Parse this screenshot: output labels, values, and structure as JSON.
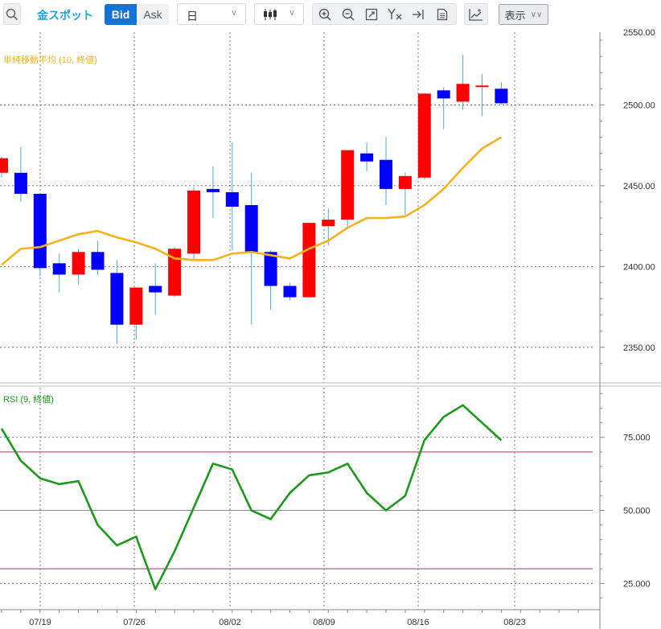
{
  "toolbar": {
    "symbol": "金スポット",
    "bid_label": "Bid",
    "ask_label": "Ask",
    "period_select": "日",
    "display_label": "表示",
    "icons": [
      "search-icon",
      "candlestick-icon",
      "zoom-in-icon",
      "zoom-out-icon",
      "fit-icon",
      "price-label-icon",
      "scroll-end-icon",
      "document-icon",
      "add-indicator-icon",
      "chevron-down-icon"
    ]
  },
  "colors": {
    "up": "#ff0000",
    "down": "#0000ff",
    "sma": "#f5b21c",
    "rsi": "#1d9a1d",
    "rsi_band": "#d94f8c",
    "grid": "#555555",
    "accent": "#1473d6"
  },
  "chart_data": [
    {
      "type": "candlestick",
      "indicator_label": "単純移動平均 (10, 終値)",
      "x_ticks": [
        "07/19",
        "07/26",
        "08/02",
        "08/09",
        "08/16",
        "08/23"
      ],
      "y_ticks": [
        "2350.00",
        "2400.00",
        "2450.00",
        "2500.00"
      ],
      "y_top_partial": "2550.00",
      "ylim": [
        2330,
        2545
      ],
      "candles": [
        {
          "o": 2458,
          "h": 2468,
          "l": 2455,
          "c": 2467
        },
        {
          "o": 2458,
          "h": 2474,
          "l": 2440,
          "c": 2445
        },
        {
          "o": 2445,
          "h": 2445,
          "l": 2394,
          "c": 2399
        },
        {
          "o": 2402,
          "h": 2408,
          "l": 2384,
          "c": 2395
        },
        {
          "o": 2395,
          "h": 2411,
          "l": 2389,
          "c": 2409
        },
        {
          "o": 2409,
          "h": 2416,
          "l": 2395,
          "c": 2398
        },
        {
          "o": 2396,
          "h": 2404,
          "l": 2352,
          "c": 2364
        },
        {
          "o": 2364,
          "h": 2387,
          "l": 2355,
          "c": 2387
        },
        {
          "o": 2388,
          "h": 2402,
          "l": 2370,
          "c": 2384
        },
        {
          "o": 2382,
          "h": 2412,
          "l": 2381,
          "c": 2411
        },
        {
          "o": 2408,
          "h": 2449,
          "l": 2404,
          "c": 2447
        },
        {
          "o": 2448,
          "h": 2462,
          "l": 2430,
          "c": 2446
        },
        {
          "o": 2446,
          "h": 2477,
          "l": 2410,
          "c": 2437
        },
        {
          "o": 2438,
          "h": 2458,
          "l": 2364,
          "c": 2409
        },
        {
          "o": 2409,
          "h": 2410,
          "l": 2373,
          "c": 2388
        },
        {
          "o": 2388,
          "h": 2390,
          "l": 2379,
          "c": 2381
        },
        {
          "o": 2381,
          "h": 2427,
          "l": 2381,
          "c": 2427
        },
        {
          "o": 2425,
          "h": 2436,
          "l": 2413,
          "c": 2429
        },
        {
          "o": 2429,
          "h": 2472,
          "l": 2424,
          "c": 2472
        },
        {
          "o": 2470,
          "h": 2477,
          "l": 2459,
          "c": 2465
        },
        {
          "o": 2466,
          "h": 2480,
          "l": 2438,
          "c": 2448
        },
        {
          "o": 2448,
          "h": 2458,
          "l": 2432,
          "c": 2456
        },
        {
          "o": 2455,
          "h": 2507,
          "l": 2454,
          "c": 2507
        },
        {
          "o": 2509,
          "h": 2511,
          "l": 2485,
          "c": 2504
        },
        {
          "o": 2502,
          "h": 2531,
          "l": 2497,
          "c": 2513
        },
        {
          "o": 2511,
          "h": 2519,
          "l": 2493,
          "c": 2512
        },
        {
          "o": 2510,
          "h": 2514,
          "l": 2500,
          "c": 2501
        }
      ],
      "sma": [
        2401,
        2411,
        2412,
        2416,
        2420,
        2422,
        2418,
        2415,
        2411,
        2405,
        2404,
        2404,
        2408,
        2409,
        2407,
        2405,
        2411,
        2416,
        2424,
        2430,
        2430,
        2431,
        2438,
        2448,
        2461,
        2473,
        2480
      ]
    },
    {
      "type": "line",
      "indicator_label": "RSI (9, 終値)",
      "y_ticks": [
        "25.000",
        "50.000",
        "75.000"
      ],
      "ylim": [
        16,
        92
      ],
      "bands": [
        70,
        30
      ],
      "values": [
        78,
        67,
        61,
        59,
        60,
        45,
        38,
        41,
        23,
        36,
        51,
        66,
        64,
        50,
        47,
        56,
        62,
        63,
        66,
        56,
        50,
        55,
        74,
        82,
        86,
        80,
        74
      ]
    }
  ]
}
